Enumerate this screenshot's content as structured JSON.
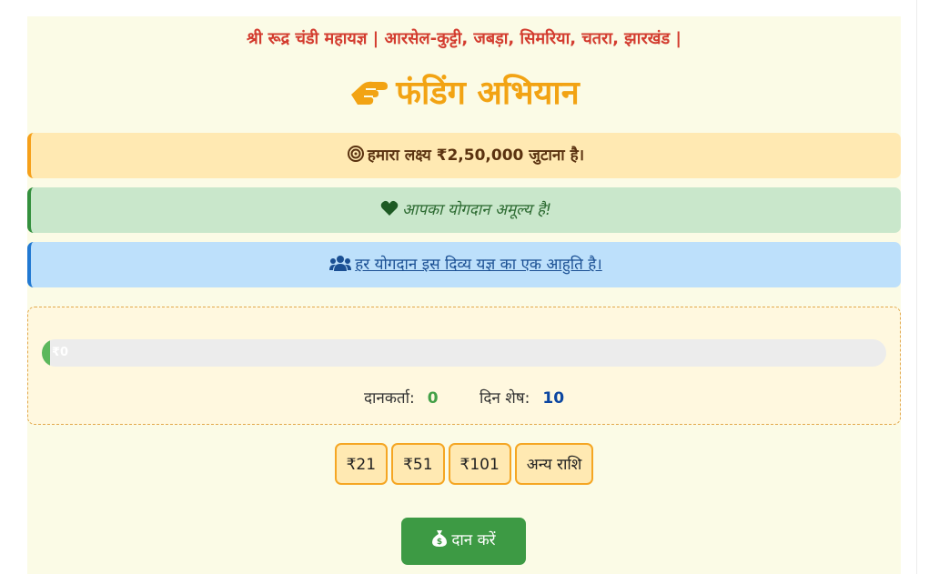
{
  "header": {
    "event_line": "श्री रूद्र चंडी महायज्ञ | आरसेल-कुट्टी, जबड़ा, सिमरिया, चतरा, झारखंड |"
  },
  "campaign": {
    "title": "फंडिंग अभियान",
    "title_icon": "hand-holding-icon"
  },
  "alerts": {
    "goal": {
      "icon": "bullseye-icon",
      "text": "हमारा लक्ष्य ₹2,50,000 जुटाना है।"
    },
    "appreciation": {
      "icon": "heart-icon",
      "text": "आपका योगदान अमूल्य है!"
    },
    "offering": {
      "icon": "users-icon",
      "text": "हर योगदान इस दिव्य यज्ञ का एक आहुति है।"
    }
  },
  "progress": {
    "raised_label": "₹0",
    "fraction": 0.0,
    "donors_label": "दानकर्ता:",
    "donors_value": "0",
    "days_label": "दिन शेष:",
    "days_value": "10"
  },
  "amounts": [
    "₹21",
    "₹51",
    "₹101",
    "अन्य राशि"
  ],
  "donate_button": {
    "label": "दान करें",
    "icon": "money-bag-icon"
  },
  "colors": {
    "header_red": "#d33c2f",
    "title_orange": "#f2a313",
    "goal_bg": "#ffe9b2",
    "love_bg": "#c9e7cb",
    "info_bg": "#bde0fb",
    "progress_green": "#5cb85c",
    "donate_green": "#3d9a44"
  }
}
